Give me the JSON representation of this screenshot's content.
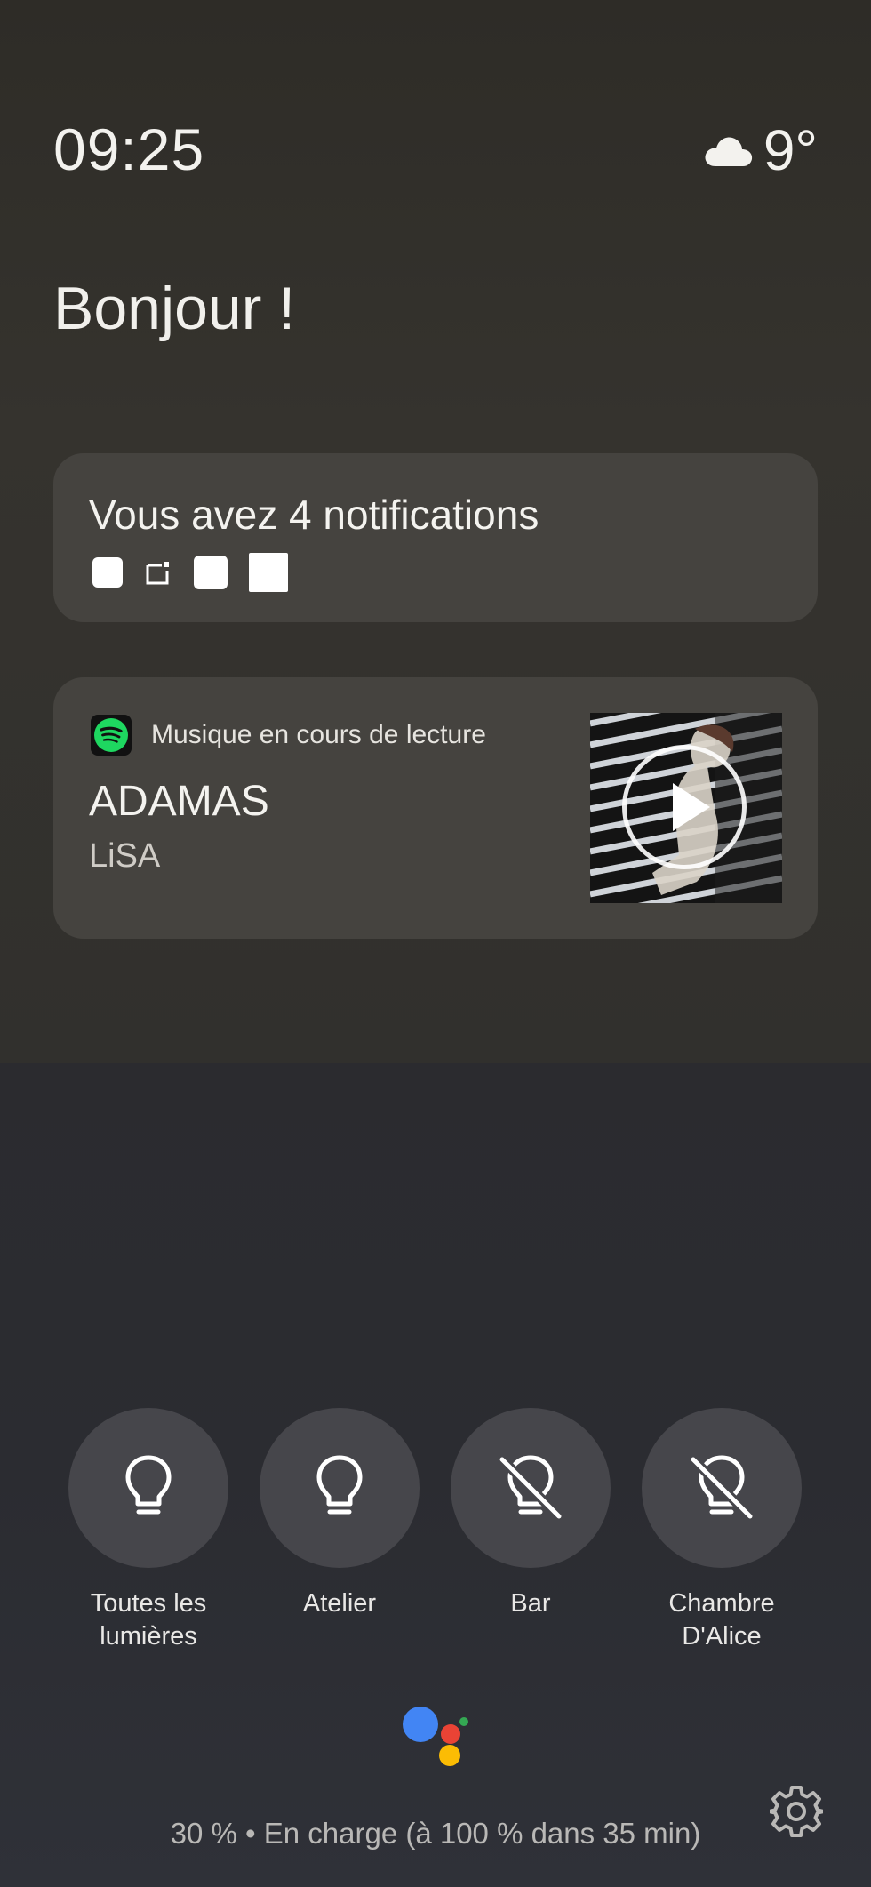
{
  "status": {
    "time": "09:25",
    "temperature": "9°",
    "weather_icon": "cloud-icon"
  },
  "greeting": "Bonjour !",
  "notifications": {
    "title": "Vous avez 4 notifications",
    "icon_count": 4
  },
  "music": {
    "source_label": "Musique en cours de lecture",
    "app_icon": "spotify-icon",
    "track": "ADAMAS",
    "artist": "LiSA"
  },
  "lights": [
    {
      "label_line1": "Toutes les",
      "label_line2": "lumières",
      "icon": "lightbulb-icon"
    },
    {
      "label_line1": "Atelier",
      "label_line2": "",
      "icon": "lightbulb-icon"
    },
    {
      "label_line1": "Bar",
      "label_line2": "",
      "icon": "lightbulb-off-icon"
    },
    {
      "label_line1": "Chambre",
      "label_line2": "D'Alice",
      "icon": "lightbulb-off-icon"
    }
  ],
  "footer": {
    "battery_text": "30 % • En charge (à 100 % dans 35 min)"
  },
  "colors": {
    "assistant_blue": "#4285f4",
    "assistant_red": "#ea4335",
    "assistant_yellow": "#fbbc04",
    "assistant_green": "#34a853",
    "spotify_green": "#1ed760"
  }
}
